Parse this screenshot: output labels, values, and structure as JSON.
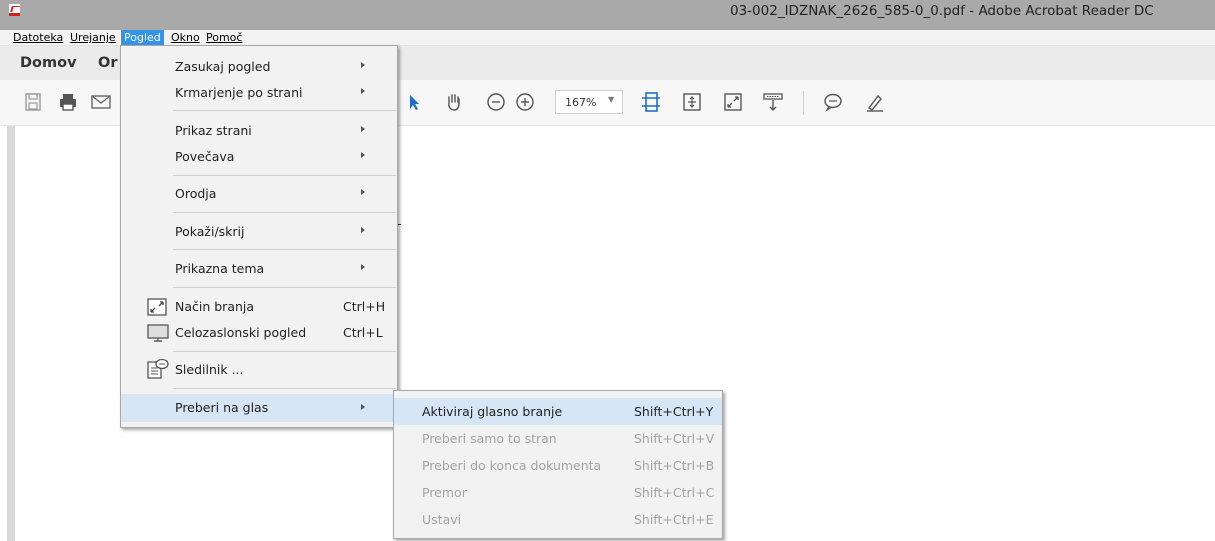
{
  "window": {
    "title": "03-002_IDZNAK_2626_585-0_0.pdf - Adobe Acrobat Reader DC"
  },
  "menubar": {
    "items": [
      {
        "label": "Datoteka"
      },
      {
        "label": "Urejanje"
      },
      {
        "label": "Pogled"
      },
      {
        "label": "Okno"
      },
      {
        "label": "Pomoč"
      }
    ]
  },
  "tabs": [
    {
      "label": "Domov"
    },
    {
      "label": "Or"
    }
  ],
  "toolbar": {
    "zoom": "167%"
  },
  "view_menu": {
    "items": [
      {
        "label": "Zasukaj pogled",
        "submenu": true
      },
      {
        "label": "Krmarjenje po strani",
        "submenu": true
      },
      {
        "label": "Prikaz strani",
        "submenu": true
      },
      {
        "label": "Povečava",
        "submenu": true
      },
      {
        "label": "Orodja",
        "submenu": true
      },
      {
        "label": "Pokaži/skrij",
        "submenu": true
      },
      {
        "label": "Prikazna tema",
        "submenu": true
      },
      {
        "label": "Način branja",
        "shortcut": "Ctrl+H",
        "icon": "reading-mode-icon"
      },
      {
        "label": "Celozaslonski pogled",
        "shortcut": "Ctrl+L",
        "icon": "fullscreen-monitor-icon"
      },
      {
        "label": "Sledilnik ...",
        "icon": "tracker-icon"
      },
      {
        "label": "Preberi na glas",
        "submenu": true,
        "highlighted": true
      }
    ]
  },
  "read_aloud_submenu": {
    "items": [
      {
        "label": "Aktiviraj glasno branje",
        "shortcut": "Shift+Ctrl+Y",
        "enabled": true
      },
      {
        "label": "Preberi samo to stran",
        "shortcut": "Shift+Ctrl+V",
        "enabled": false
      },
      {
        "label": "Preberi do konca dokumenta",
        "shortcut": "Shift+Ctrl+B",
        "enabled": false
      },
      {
        "label": "Premor",
        "shortcut": "Shift+Ctrl+C",
        "enabled": false
      },
      {
        "label": "Ustavi",
        "shortcut": "Shift+Ctrl+E",
        "enabled": false
      }
    ]
  },
  "colors": {
    "accent": "#3593e8",
    "menu_hover": "#d7e6f5",
    "disabled_text": "#a3a3a3",
    "titlebar": "#a9a9a9"
  }
}
